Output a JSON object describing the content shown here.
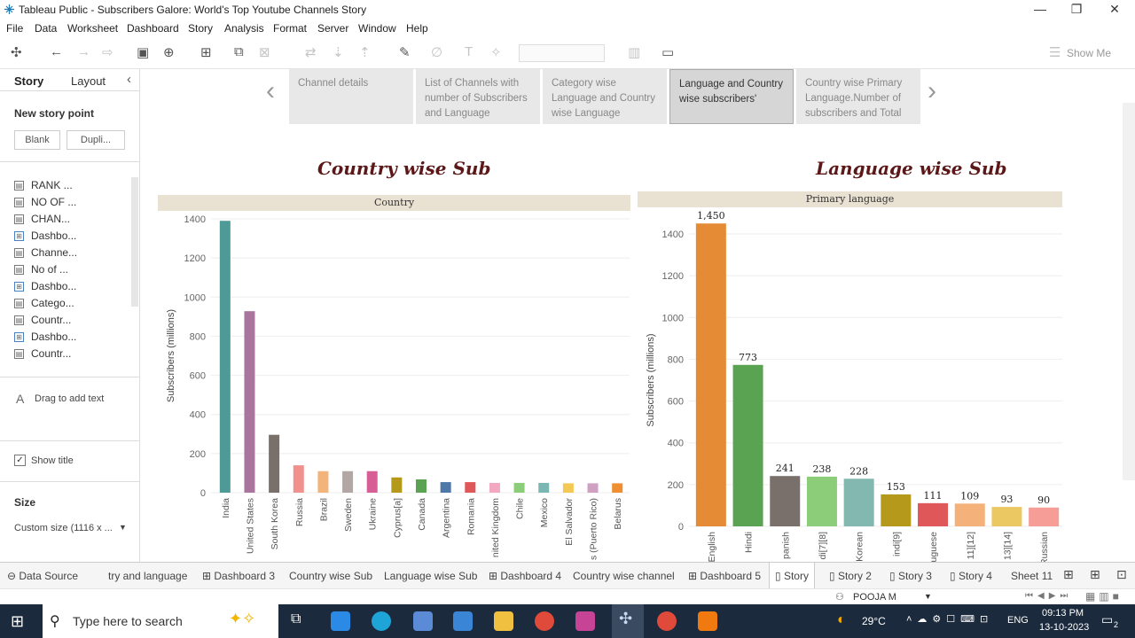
{
  "window": {
    "title": "Tableau Public - Subscribers Galore: World's Top Youtube Channels Story",
    "minimize": "—",
    "restore": "❐",
    "close": "✕"
  },
  "menu": [
    "File",
    "Data",
    "Worksheet",
    "Dashboard",
    "Story",
    "Analysis",
    "Format",
    "Server",
    "Window",
    "Help"
  ],
  "toolbar": {
    "show_me": "Show Me"
  },
  "left_panel": {
    "tab_story": "Story",
    "tab_layout": "Layout",
    "collapse": "‹",
    "new_story_point": "New story point",
    "btn_blank": "Blank",
    "btn_duplicate": "Dupli...",
    "sheets": [
      "RANK ...",
      "NO OF ...",
      "CHAN...",
      "Dashbo...",
      "Channe...",
      "No of ...",
      "Dashbo...",
      "Catego...",
      "Countr...",
      "Dashbo...",
      "Countr..."
    ],
    "drag_text": "Drag to add text",
    "show_title": "Show title",
    "size_label": "Size",
    "size_value": "Custom size (1116 x ..."
  },
  "story_points": [
    "Channel details",
    "List of Channels with number of Subscribers and Language",
    "Category wise Language and Country wise Language",
    "Language and Country wise subscribers'",
    "Country wise Primary Language.Number of subscribers and Total"
  ],
  "charts": {
    "left_title": "Country wise Sub",
    "left_header": "Country",
    "right_title": "Language wise Sub",
    "right_header": "Primary language",
    "ylabel": "Subscribers (millions)"
  },
  "chart_data": [
    {
      "type": "bar",
      "title": "Country wise Sub",
      "xlabel": "Country",
      "ylabel": "Subscribers (millions)",
      "ylim": [
        0,
        1400
      ],
      "yticks": [
        0,
        200,
        400,
        600,
        800,
        1000,
        1200,
        1400
      ],
      "categories": [
        "India",
        "United States",
        "South Korea",
        "Russia",
        "Brazil",
        "Sweden",
        "Ukraine",
        "Cyprus[a]",
        "Canada",
        "Argentina",
        "Romania",
        "nited Kingdom",
        "Chile",
        "Mexico",
        "El Salvador",
        "s (Puerto Rico)",
        "Belarus"
      ],
      "values": [
        1390,
        928,
        296,
        140,
        110,
        110,
        110,
        78,
        68,
        54,
        54,
        50,
        50,
        50,
        48,
        48,
        48
      ],
      "colors": [
        "#4e9a96",
        "#a9759d",
        "#7a706b",
        "#f0918d",
        "#f3b47c",
        "#b2a7a4",
        "#d65f96",
        "#b5991a",
        "#5aa352",
        "#4d78a8",
        "#e05759",
        "#f2a8c0",
        "#8ccd7a",
        "#7ab7b2",
        "#f4c953",
        "#cfa0c2",
        "#f08f32"
      ]
    },
    {
      "type": "bar",
      "title": "Language wise Sub",
      "xlabel": "Primary language",
      "ylabel": "Subscribers (millions)",
      "ylim": [
        0,
        1400
      ],
      "yticks": [
        0,
        200,
        400,
        600,
        800,
        1000,
        1200,
        1400
      ],
      "categories": [
        "English",
        "Hindi",
        "panish",
        "di[7][8]",
        "Korean",
        "indi[9]",
        "uguese",
        "11][12]",
        "13][14]",
        "Russian"
      ],
      "values": [
        1450,
        773,
        241,
        238,
        228,
        153,
        111,
        109,
        93,
        90
      ],
      "labels": [
        "1,450",
        "773",
        "241",
        "238",
        "228",
        "153",
        "111",
        "109",
        "93",
        "90"
      ],
      "colors": [
        "#e58b35",
        "#5aa352",
        "#7a706b",
        "#8ccd7a",
        "#82b8b0",
        "#b5991a",
        "#e05759",
        "#f4b27a",
        "#ecc863",
        "#f59d96"
      ]
    }
  ],
  "sheet_tabs": {
    "data_source": "Data Source",
    "tabs": [
      "try and language",
      "Dashboard 3",
      "Country wise Sub",
      "Language wise Sub",
      "Dashboard 4",
      "Country wise channel",
      "Dashboard 5",
      "Story",
      "Story 2",
      "Story 3",
      "Story 4",
      "Sheet 11"
    ]
  },
  "status": {
    "user": "POOJA M"
  },
  "taskbar": {
    "search_placeholder": "Type here to search",
    "temperature": "29°C",
    "lang": "ENG",
    "time": "09:13 PM",
    "date": "13-10-2023",
    "notifications": "2"
  }
}
